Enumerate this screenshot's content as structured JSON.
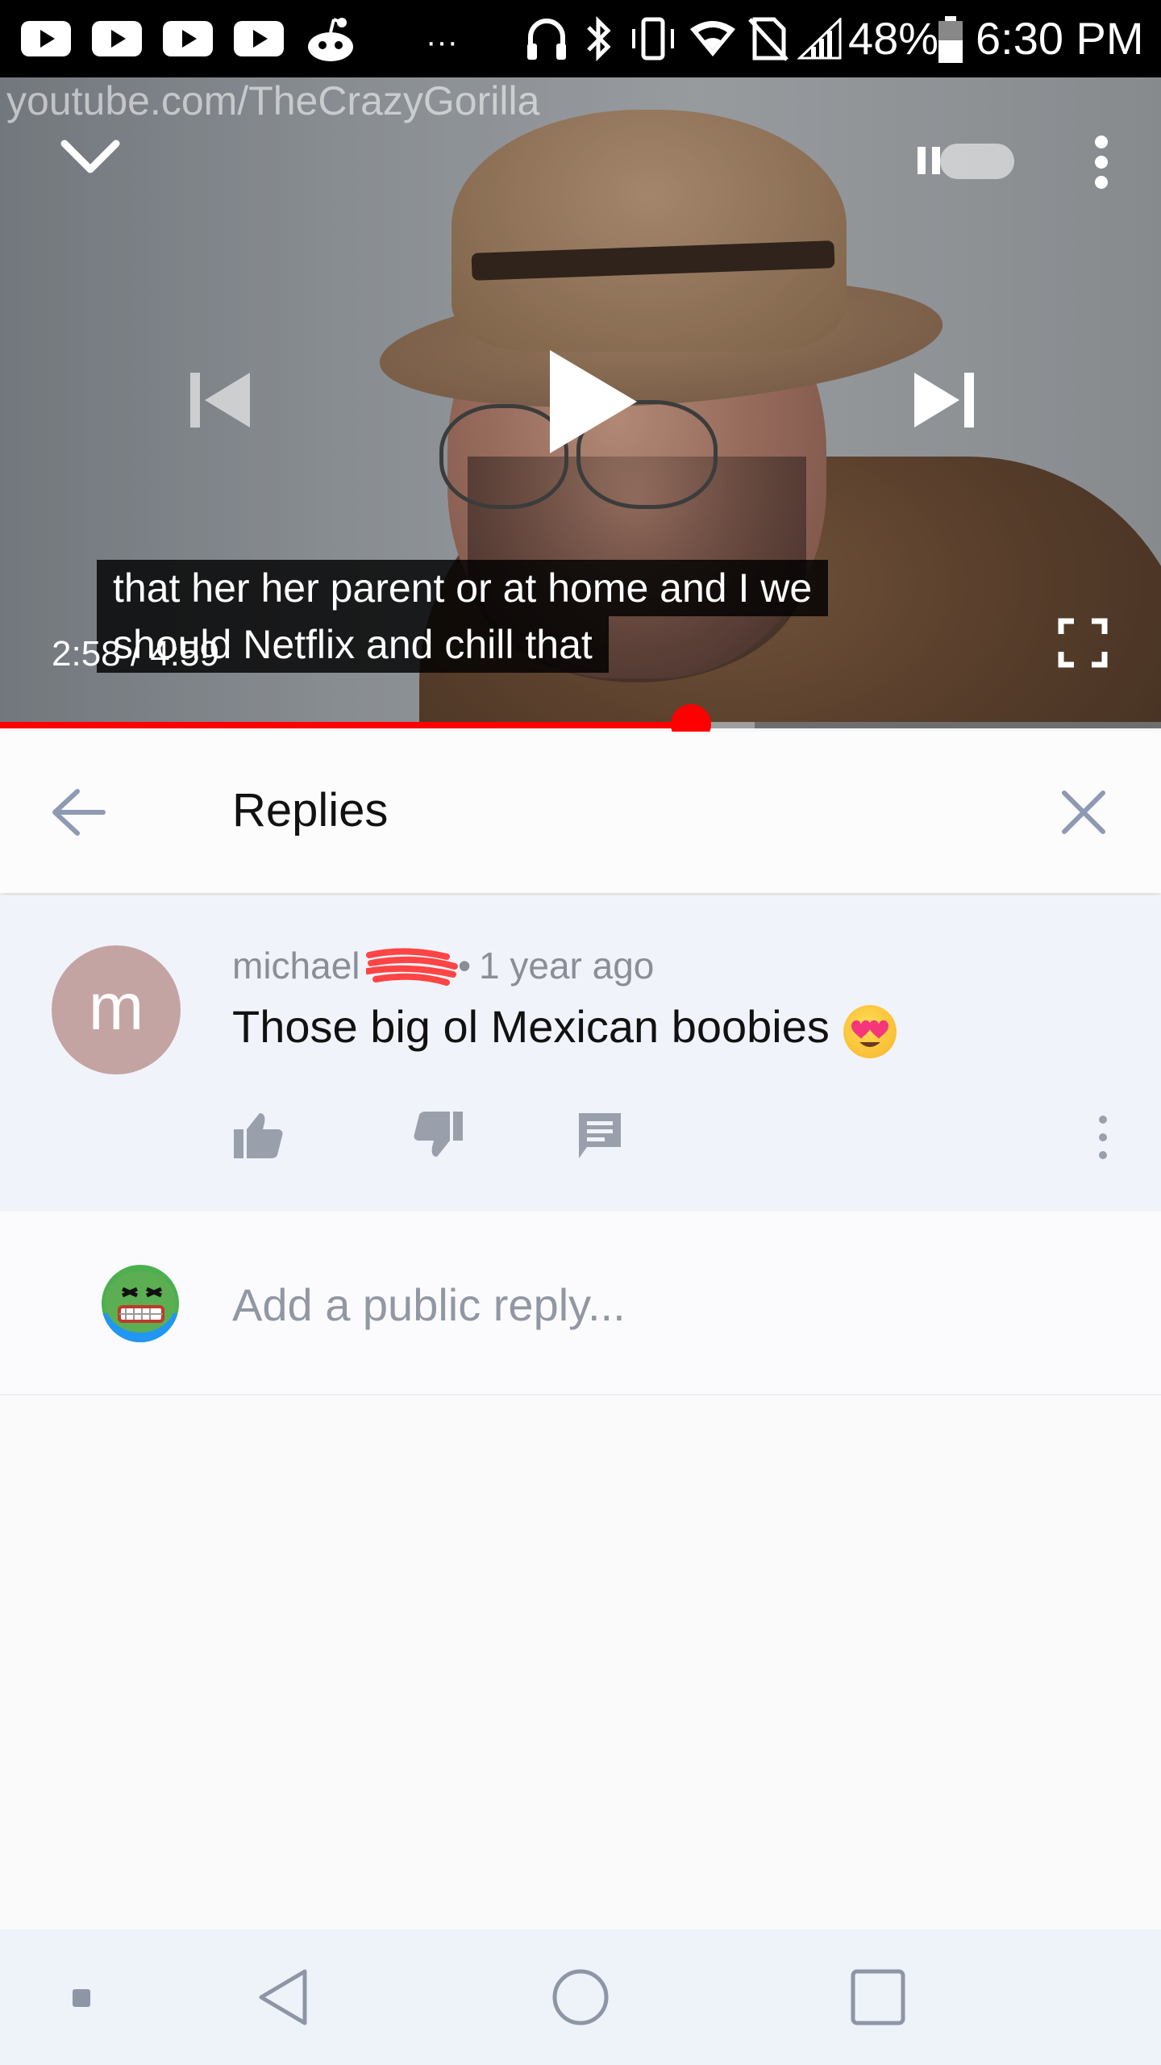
{
  "status_bar": {
    "more_indicator": "···",
    "battery_percent": "48%",
    "time": "6:30 PM"
  },
  "video": {
    "watermark": "youtube.com/TheCrazyGorilla",
    "captions": [
      "that her her parent or at home and I we",
      "should Netflix and chill that"
    ],
    "current_time": "2:58",
    "duration": "4:59",
    "time_display": "2:58 / 4:59",
    "progress_fraction": 0.595,
    "buffered_fraction": 0.65,
    "colors": {
      "progress": "#ff0000"
    }
  },
  "replies_panel": {
    "title": "Replies"
  },
  "comment": {
    "avatar_letter": "m",
    "author": "michael",
    "separator": "•",
    "time_ago": "1 year ago",
    "text": "Those big ol Mexican boobies",
    "emoji": "heart-eyes-emoji"
  },
  "reply_box": {
    "placeholder": "Add a public reply..."
  },
  "nav_bar": {
    "icons": [
      "recent-dot-icon",
      "back-triangle-icon",
      "home-circle-icon",
      "overview-square-icon"
    ]
  }
}
